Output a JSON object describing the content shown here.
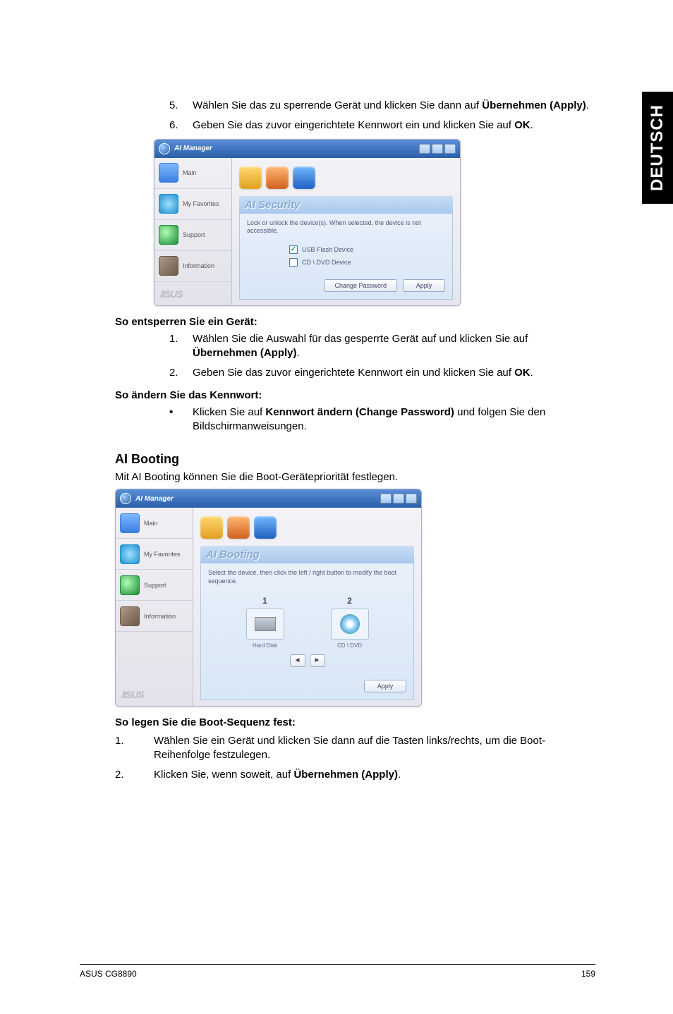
{
  "side_tab": "DEUTSCH",
  "steps_top": [
    {
      "n": "5.",
      "pre": "Wählen Sie das zu sperrende Gerät und klicken Sie dann auf ",
      "bold": "Übernehmen (Apply)",
      "post": "."
    },
    {
      "n": "6.",
      "pre": "Geben Sie das zuvor eingerichtete Kennwort ein und klicken Sie auf ",
      "bold": "OK",
      "post": "."
    }
  ],
  "ai_security": {
    "window_title": "AI Manager",
    "tabs": {
      "main": "Main",
      "fav": "My Favorites",
      "support": "Support",
      "info": "Information"
    },
    "brand": "/ISUS",
    "panel_title": "AI Security",
    "desc": "Lock or unlock the device(s). When selected, the device is not accessible.",
    "opt1": "USB Flash Device",
    "opt2": "CD \\ DVD Device",
    "btn_change": "Change Password",
    "btn_apply": "Apply"
  },
  "heading_unlock": "So entsperren Sie ein Gerät:",
  "steps_unlock": [
    {
      "n": "1.",
      "pre": "Wählen Sie die Auswahl für das gesperrte Gerät auf und klicken Sie auf ",
      "bold": "Übernehmen (Apply)",
      "post": "."
    },
    {
      "n": "2.",
      "pre": "Geben Sie das zuvor eingerichtete Kennwort ein und klicken Sie auf ",
      "bold": "OK",
      "post": "."
    }
  ],
  "heading_changepw": "So ändern Sie das Kennwort:",
  "bullet_changepw": {
    "pre": "Klicken Sie auf ",
    "bold": "Kennwort ändern (Change Password)",
    "post": " und folgen Sie den Bildschirmanweisungen."
  },
  "heading_booting": "AI Booting",
  "booting_intro": "Mit AI Booting können Sie die Boot-Gerätepriorität festlegen.",
  "ai_booting": {
    "window_title": "AI Manager",
    "panel_title": "AI Booting",
    "desc": "Select the device, then click the left / right button to modify the boot sequence.",
    "dev1_label": "Hard Disk",
    "dev2_label": "CD \\ DVD",
    "btn_apply": "Apply"
  },
  "heading_bootseq": "So legen Sie die Boot-Sequenz fest:",
  "steps_boot": [
    {
      "n": "1.",
      "pre": "Wählen Sie ein Gerät und klicken Sie dann auf die Tasten links/rechts, um die Boot-Reihenfolge festzulegen.",
      "bold": "",
      "post": ""
    },
    {
      "n": "2.",
      "pre": "Klicken Sie, wenn soweit, auf ",
      "bold": "Übernehmen (Apply)",
      "post": "."
    }
  ],
  "footer_left": "ASUS CG8890",
  "footer_right": "159"
}
